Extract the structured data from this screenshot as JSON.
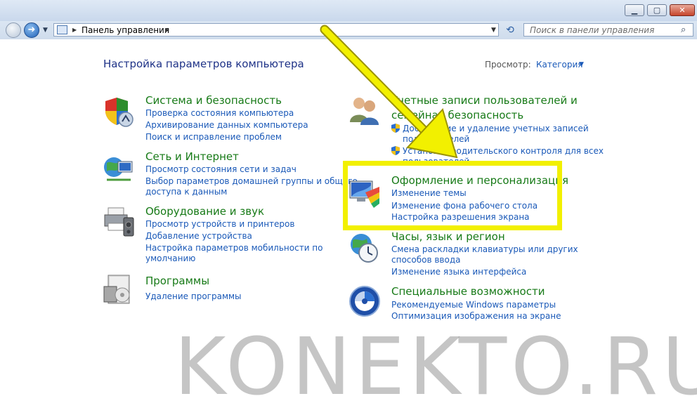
{
  "address": {
    "path": "Панель управления",
    "search_placeholder": "Поиск в панели управления"
  },
  "header": {
    "title": "Настройка параметров компьютера",
    "view_label": "Просмотр:",
    "view_value": "Категория"
  },
  "categories": [
    {
      "title": "Система и безопасность",
      "links": [
        "Проверка состояния компьютера",
        "Архивирование данных компьютера",
        "Поиск и исправление проблем"
      ]
    },
    {
      "title": "Сеть и Интернет",
      "links": [
        "Просмотр состояния сети и задач",
        "Выбор параметров домашней группы и общего",
        "доступа к данным"
      ]
    },
    {
      "title": "Оборудование и звук",
      "links": [
        "Просмотр устройств и принтеров",
        "Добавление устройства",
        "Настройка параметров мобильности по",
        "умолчанию"
      ]
    },
    {
      "title": "Программы",
      "links": [
        "Удаление программы"
      ]
    },
    {
      "title": "Учетные записи пользователей и",
      "title2": "семейная безопасность",
      "links": [
        "Добавление и удаление учетных записей",
        "пользователей",
        "Установка родительского контроля для всех",
        "пользователей"
      ]
    },
    {
      "title": "Оформление и персонализация",
      "links": [
        "Изменение темы",
        "Изменение фона рабочего стола",
        "Настройка разрешения экрана"
      ]
    },
    {
      "title": "Часы, язык и регион",
      "links": [
        "Смена раскладки клавиатуры или других",
        "способов ввода",
        "Изменение языка интерфейса"
      ]
    },
    {
      "title": "Специальные возможности",
      "links": [
        "Рекомендуемые Windows параметры",
        "Оптимизация изображения на экране"
      ]
    }
  ],
  "watermark": "KONEKTO.RU",
  "colors": {
    "highlight": "#f2f000",
    "category_title": "#177a17",
    "link": "#1a59b8"
  }
}
